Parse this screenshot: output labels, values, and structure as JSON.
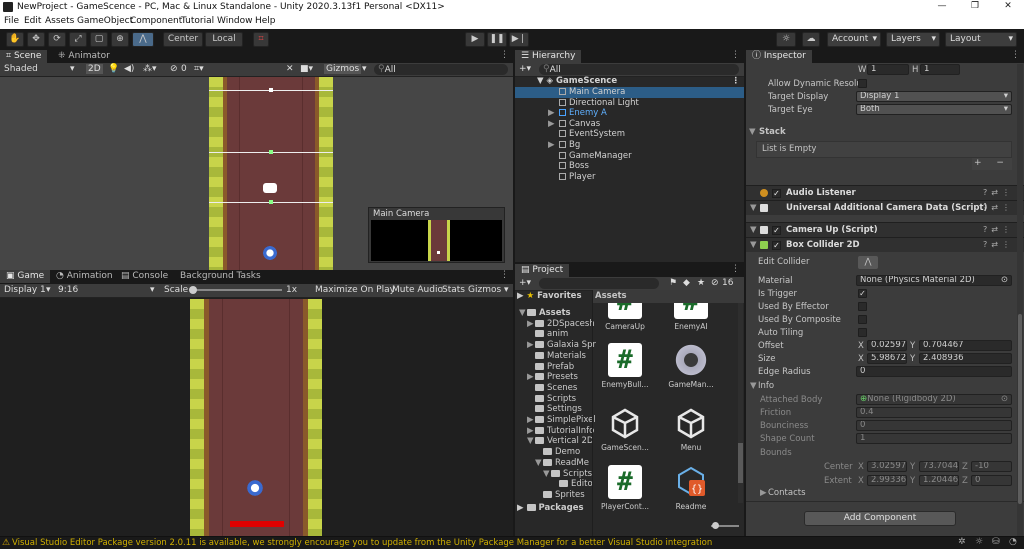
{
  "window": {
    "title": "NewProject - GameScence - PC, Mac & Linux Standalone - Unity 2020.3.13f1 Personal <DX11>",
    "min_glyph": "—",
    "max_glyph": "❐",
    "close_glyph": "✕"
  },
  "menu": [
    "File",
    "Edit",
    "Assets",
    "GameObject",
    "Component",
    "Tutorial",
    "Window",
    "Help"
  ],
  "toolbar": {
    "pivot_mode": "Center",
    "pivot_rotation": "Local",
    "account": "Account",
    "layers": "Layers",
    "layout": "Layout"
  },
  "scene": {
    "tab_scene": "Scene",
    "tab_animator": "Animator",
    "shading": "Shaded",
    "mode_2d": "2D",
    "fx_count": "0",
    "gizmos": "Gizmos",
    "search_placeholder": "All",
    "camera_preview_title": "Main Camera"
  },
  "game": {
    "tab_game": "Game",
    "tab_animation": "Animation",
    "tab_console": "Console",
    "tab_background": "Background Tasks",
    "display": "Display 1",
    "aspect": "9:16",
    "scale_label": "Scale",
    "scale_value": "1x",
    "maximize": "Maximize On Play",
    "mute": "Mute Audio",
    "stats": "Stats",
    "gizmos": "Gizmos"
  },
  "hierarchy": {
    "tab": "Hierarchy",
    "search_placeholder": "All",
    "scene_name": "GameScence",
    "items": [
      {
        "label": "Main Camera",
        "selected": true,
        "arrow": "",
        "prefab": false
      },
      {
        "label": "Directional Light",
        "selected": false,
        "arrow": "",
        "prefab": false
      },
      {
        "label": "Enemy A",
        "selected": false,
        "arrow": "▶",
        "prefab": true
      },
      {
        "label": "Canvas",
        "selected": false,
        "arrow": "▶",
        "prefab": false
      },
      {
        "label": "EventSystem",
        "selected": false,
        "arrow": "",
        "prefab": false
      },
      {
        "label": "Bg",
        "selected": false,
        "arrow": "▶",
        "prefab": false
      },
      {
        "label": "GameManager",
        "selected": false,
        "arrow": "",
        "prefab": false
      },
      {
        "label": "Boss",
        "selected": false,
        "arrow": "",
        "prefab": false
      },
      {
        "label": "Player",
        "selected": false,
        "arrow": "",
        "prefab": false
      }
    ]
  },
  "project": {
    "tab": "Project",
    "hidden_count": "16",
    "favorites": "Favorites",
    "assets_header": "Assets",
    "packages": "Packages",
    "tree": [
      {
        "label": "Assets",
        "indent": 0,
        "arrow": "▼",
        "bold": true
      },
      {
        "label": "2DSpacesh",
        "indent": 1,
        "arrow": "▶",
        "bold": false
      },
      {
        "label": "anim",
        "indent": 1,
        "arrow": "",
        "bold": false
      },
      {
        "label": "Galaxia Spr",
        "indent": 1,
        "arrow": "▶",
        "bold": false
      },
      {
        "label": "Materials",
        "indent": 1,
        "arrow": "",
        "bold": false
      },
      {
        "label": "Prefab",
        "indent": 1,
        "arrow": "",
        "bold": false
      },
      {
        "label": "Presets",
        "indent": 1,
        "arrow": "▶",
        "bold": false
      },
      {
        "label": "Scenes",
        "indent": 1,
        "arrow": "",
        "bold": false
      },
      {
        "label": "Scripts",
        "indent": 1,
        "arrow": "",
        "bold": false
      },
      {
        "label": "Settings",
        "indent": 1,
        "arrow": "",
        "bold": false
      },
      {
        "label": "SimplePixel",
        "indent": 1,
        "arrow": "▶",
        "bold": false
      },
      {
        "label": "TutorialInfo",
        "indent": 1,
        "arrow": "▶",
        "bold": false
      },
      {
        "label": "Vertical 2D",
        "indent": 1,
        "arrow": "▼",
        "bold": false
      },
      {
        "label": "Demo",
        "indent": 2,
        "arrow": "",
        "bold": false
      },
      {
        "label": "ReadMe",
        "indent": 2,
        "arrow": "▼",
        "bold": false
      },
      {
        "label": "Scripts",
        "indent": 3,
        "arrow": "▼",
        "bold": false
      },
      {
        "label": "Edito",
        "indent": 4,
        "arrow": "",
        "bold": false
      },
      {
        "label": "Sprites",
        "indent": 2,
        "arrow": "",
        "bold": false
      }
    ],
    "assets": [
      {
        "label": "CameraUp",
        "kind": "cs"
      },
      {
        "label": "EnemyAI",
        "kind": "cs"
      },
      {
        "label": "EnemyBull...",
        "kind": "cs"
      },
      {
        "label": "GameMan...",
        "kind": "gear"
      },
      {
        "label": "GameScen...",
        "kind": "unity"
      },
      {
        "label": "Menu",
        "kind": "unity"
      },
      {
        "label": "PlayerCont...",
        "kind": "cs"
      },
      {
        "label": "Readme",
        "kind": "readme"
      }
    ]
  },
  "inspector": {
    "tab": "Inspector",
    "w_label": "W",
    "w_value": "1",
    "h_label": "H",
    "h_value": "1",
    "allow_dynamic": "Allow Dynamic Resolut",
    "target_display_label": "Target Display",
    "target_display_value": "Display 1",
    "target_eye_label": "Target Eye",
    "target_eye_value": "Both",
    "stack_label": "Stack",
    "stack_empty": "List is Empty",
    "components": {
      "audio_listener": "Audio Listener",
      "urp_camera": "Universal Additional Camera Data (Script)",
      "camera_up": "Camera Up (Script)",
      "box_collider": "Box Collider 2D"
    },
    "box": {
      "edit_collider": "Edit Collider",
      "material_label": "Material",
      "material_value": "None (Physics Material 2D)",
      "is_trigger": "Is Trigger",
      "used_by_effector": "Used By Effector",
      "used_by_composite": "Used By Composite",
      "auto_tiling": "Auto Tiling",
      "offset_label": "Offset",
      "offset_x": "0.025972",
      "offset_y": "0.704467",
      "size_label": "Size",
      "size_x": "5.986721",
      "size_y": "2.408936",
      "edge_radius_label": "Edge Radius",
      "edge_radius_value": "0",
      "info": "Info",
      "attached_body_label": "Attached Body",
      "attached_body_value": "None (Rigidbody 2D)",
      "friction_label": "Friction",
      "friction_value": "0.4",
      "bounciness_label": "Bounciness",
      "bounciness_value": "0",
      "shape_count_label": "Shape Count",
      "shape_count_value": "1",
      "bounds_label": "Bounds",
      "center_label": "Center",
      "center_x": "3.025972",
      "center_y": "73.70447",
      "center_z": "-10",
      "extent_label": "Extent",
      "extent_x": "2.993361",
      "extent_y": "1.204468",
      "extent_z": "0",
      "contacts": "Contacts",
      "x": "X",
      "y": "Y",
      "z": "Z"
    },
    "add_component": "Add Component"
  },
  "status": {
    "message": "Visual Studio Editor Package version 2.0.11 is available, we strongly encourage you to update from the Unity Package Manager for a better Visual Studio integration"
  },
  "colors": {
    "accent_selected": "#2c5d87",
    "road": "#6b3a3a",
    "grass": "#c8d44a",
    "health_bar": "#e00000",
    "warning": "#d0b000"
  }
}
